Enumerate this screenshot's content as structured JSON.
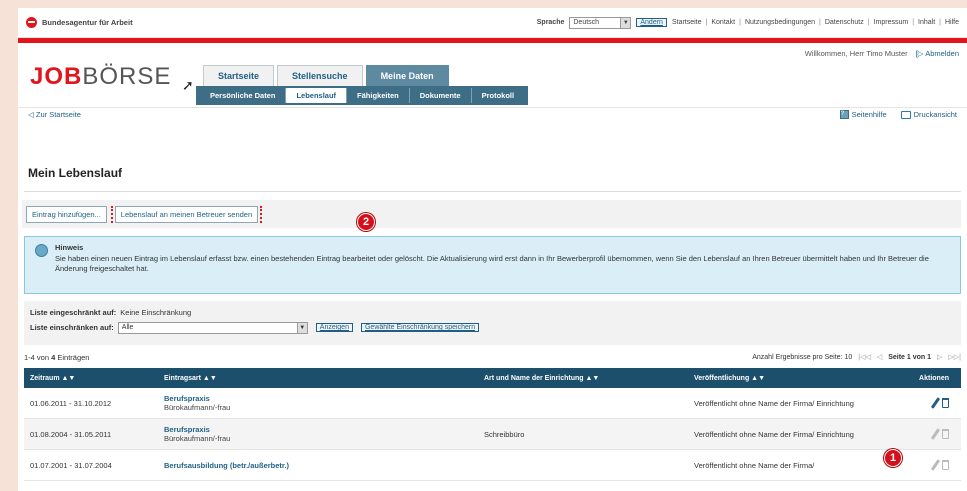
{
  "topbar": {
    "brand": "Bundesagentur für Arbeit",
    "language_label": "Sprache",
    "language_value": "Deutsch",
    "change_button": "Ändern",
    "links": [
      "Startseite",
      "Kontakt",
      "Nutzungsbedingungen",
      "Datenschutz",
      "Impressum",
      "Inhalt",
      "Hilfe"
    ]
  },
  "header": {
    "logo_job": "JOB",
    "logo_boerse": "BÖRSE",
    "welcome": "Willkommen, Herr Timo Muster",
    "logout": "Abmelden",
    "main_tabs": [
      "Startseite",
      "Stellensuche",
      "Meine Daten"
    ],
    "sub_tabs": [
      "Persönliche Daten",
      "Lebenslauf",
      "Fähigkeiten",
      "Dokumente",
      "Protokoll"
    ],
    "back_link": "Zur Startseite",
    "help_link": "Seitenhilfe",
    "print_link": "Druckansicht"
  },
  "section": {
    "title": "Mein Lebenslauf",
    "add_button": "Eintrag hinzufügen...",
    "send_button": "Lebenslauf an meinen Betreuer senden",
    "badge_2": "2",
    "badge_1": "1"
  },
  "hint": {
    "title": "Hinweis",
    "text": "Sie haben einen neuen Eintrag im Lebenslauf erfasst bzw. einen bestehenden Eintrag bearbeitet oder gelöscht. Die Aktualisierung wird erst dann in Ihr Bewerberprofil übernommen, wenn Sie den Lebenslauf an Ihren Betreuer übermittelt haben und Ihr Betreuer die Änderung freigeschaltet hat."
  },
  "filter": {
    "restricted_label": "Liste eingeschränkt auf:",
    "restricted_value": "Keine Einschränkung",
    "restrict_label": "Liste einschränken auf:",
    "restrict_value": "Alle",
    "show_button": "Anzeigen",
    "save_button": "Gewählte Einschränkung speichern"
  },
  "pagination": {
    "count_prefix": "1-4 von ",
    "count_total": "4",
    "count_suffix": " Einträgen",
    "per_page": "Anzahl Ergebnisse pro Seite: 10",
    "page_info": "Seite 1 von 1"
  },
  "table": {
    "headers": [
      "Zeitraum",
      "Eintragsart",
      "Art und Name der Einrichtung",
      "Veröffentlichung",
      "Aktionen"
    ],
    "rows": [
      {
        "period": "01.06.2011 - 31.10.2012",
        "type": "Berufspraxis",
        "subtype": "Bürokaufmann/-frau",
        "institution": "",
        "publish": "Veröffentlicht ohne Name der Firma/ Einrichtung",
        "actions_enabled": true
      },
      {
        "period": "01.08.2004 - 31.05.2011",
        "type": "Berufspraxis",
        "subtype": "Bürokaufmann/-frau",
        "institution": "Schreibbüro",
        "publish": "Veröffentlicht ohne Name der Firma/ Einrichtung",
        "actions_enabled": false
      },
      {
        "period": "01.07.2001 - 31.07.2004",
        "type": "Berufsausbildung (betr./außerbetr.)",
        "subtype": "",
        "institution": "",
        "publish": "Veröffentlicht ohne Name der Firma/",
        "actions_enabled": false
      }
    ]
  }
}
